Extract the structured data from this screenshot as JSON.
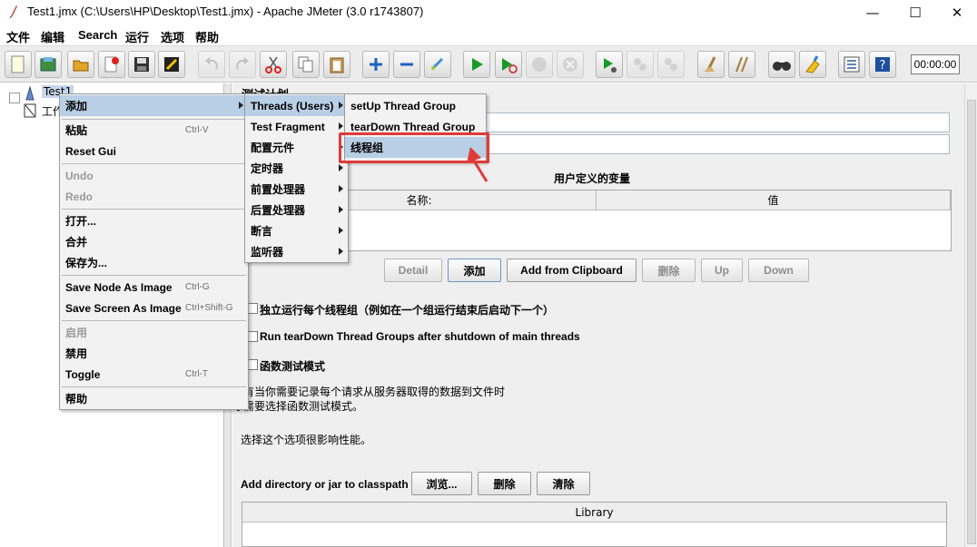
{
  "window": {
    "title": "Test1.jmx (C:\\Users\\HP\\Desktop\\Test1.jmx) - Apache JMeter (3.0 r1743807)",
    "minimize": "—",
    "maximize": "☐",
    "close": "✕"
  },
  "menubar": [
    "文件",
    "编辑",
    "Search",
    "运行",
    "选项",
    "帮助"
  ],
  "toolbar": {
    "icons": [
      "new-icon",
      "templates-icon",
      "open-icon",
      "close-icon",
      "save-icon",
      "save-as-image-icon",
      "undo-icon",
      "redo-icon",
      "cut-icon",
      "copy-icon",
      "paste-icon",
      "expand-icon",
      "collapse-icon",
      "toggle-icon",
      "start-icon",
      "start-no-pause-icon",
      "stop-icon",
      "shutdown-icon",
      "remote-start-icon",
      "remote-stop-icon",
      "remote-shutdown-icon",
      "clear-icon",
      "clear-all-icon",
      "search-icon",
      "reset-search-icon",
      "function-helper-icon",
      "help-icon"
    ],
    "timer": "00:00:00"
  },
  "tree": {
    "root": "Test1",
    "workbench": "工作台"
  },
  "right_panel": {
    "title": "测试计划",
    "user_vars_title": "用户定义的变量",
    "col_name": "名称:",
    "col_value": "值",
    "buttons": [
      "Detail",
      "添加",
      "Add from Clipboard",
      "删除",
      "Up",
      "Down"
    ],
    "opt_serialize": "独立运行每个线程组（例如在一个组运行结束后启动下一个）",
    "opt_teardown": "Run tearDown Thread Groups after shutdown of main threads",
    "opt_functional": "函数测试模式",
    "note1": "只有当你需要记录每个请求从服务器取得的数据到文件时",
    "note2": "才需要选择函数测试模式。",
    "note3": "选择这个选项很影响性能。",
    "classpath_label": "Add directory or jar to classpath",
    "browse": "浏览...",
    "delete": "删除",
    "clear": "清除",
    "library": "Library"
  },
  "context_menu": {
    "add": "添加",
    "paste": "粘贴",
    "paste_sc": "Ctrl-V",
    "reset_gui": "Reset Gui",
    "undo": "Undo",
    "redo": "Redo",
    "open": "打开...",
    "merge": "合并",
    "save_as": "保存为...",
    "save_node_img": "Save Node As Image",
    "save_node_img_sc": "Ctrl-G",
    "save_screen_img": "Save Screen As Image",
    "save_screen_img_sc": "Ctrl+Shift-G",
    "enable": "启用",
    "disable": "禁用",
    "toggle": "Toggle",
    "toggle_sc": "Ctrl-T",
    "help": "帮助"
  },
  "add_submenu": [
    "Threads (Users)",
    "Test Fragment",
    "配置元件",
    "定时器",
    "前置处理器",
    "后置处理器",
    "断言",
    "监听器"
  ],
  "threads_submenu": [
    "setUp Thread Group",
    "tearDown Thread Group",
    "线程组"
  ],
  "colors": {
    "highlight": "#b8cfe5",
    "annotation": "#e03a3a"
  }
}
